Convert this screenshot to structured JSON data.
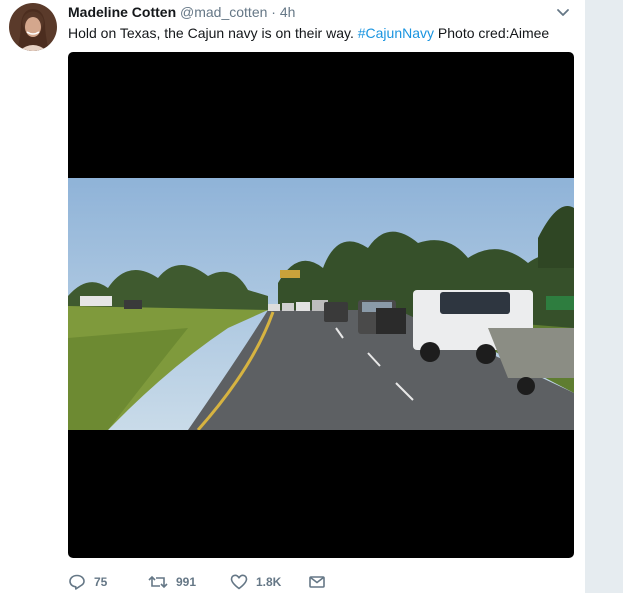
{
  "tweet": {
    "author": {
      "display_name": "Madeline Cotten",
      "handle": "@mad_cotten",
      "separator": "·",
      "time": "4h"
    },
    "text_before": "Hold on Texas, the Cajun navy is on their way. ",
    "hashtag": "#CajunNavy",
    "text_after": " Photo cred:Aimee",
    "media": {
      "description_icon": "photo-of-highway-traffic"
    },
    "actions": {
      "reply_count": "75",
      "retweet_count": "991",
      "like_count": "1.8K"
    }
  },
  "colors": {
    "link": "#1b95e0",
    "muted": "#657786",
    "right_rail": "#e6ecf0"
  }
}
